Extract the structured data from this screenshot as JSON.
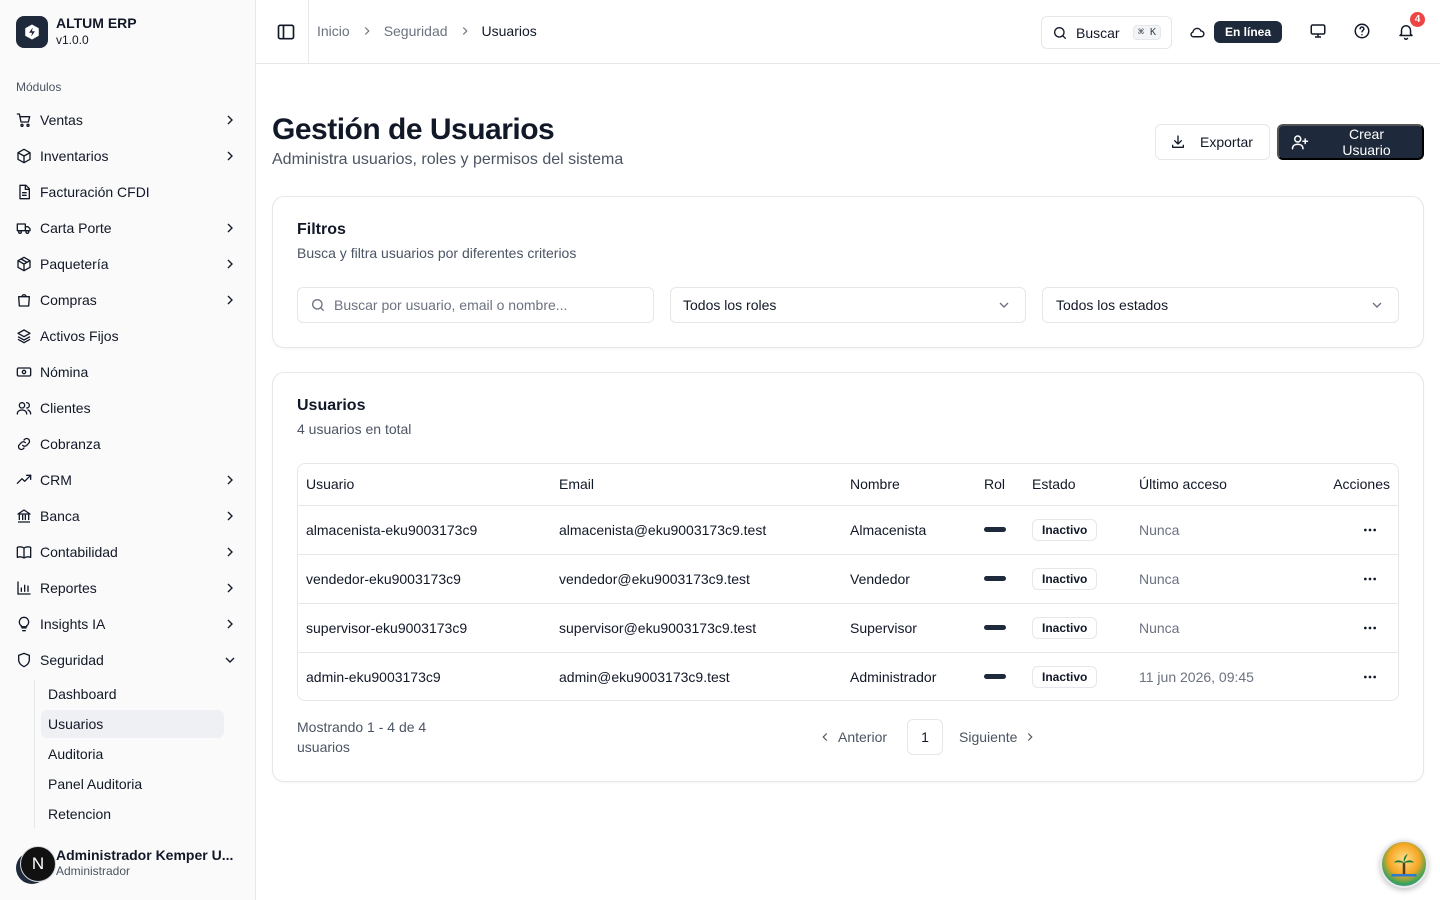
{
  "brand": {
    "name": "ALTUM ERP",
    "version": "v1.0.0"
  },
  "sidebar": {
    "section_label": "Módulos",
    "items": [
      {
        "label": "Ventas",
        "icon": "cart-icon",
        "expandable": true
      },
      {
        "label": "Inventarios",
        "icon": "box-icon",
        "expandable": true
      },
      {
        "label": "Facturación CFDI",
        "icon": "file-icon",
        "expandable": false
      },
      {
        "label": "Carta Porte",
        "icon": "truck-icon",
        "expandable": true
      },
      {
        "label": "Paquetería",
        "icon": "package-icon",
        "expandable": true
      },
      {
        "label": "Compras",
        "icon": "shopping-bag-icon",
        "expandable": true
      },
      {
        "label": "Activos Fijos",
        "icon": "layers-icon",
        "expandable": false
      },
      {
        "label": "Nómina",
        "icon": "banknote-icon",
        "expandable": false
      },
      {
        "label": "Clientes",
        "icon": "users-icon",
        "expandable": false
      },
      {
        "label": "Cobranza",
        "icon": "link-icon",
        "expandable": false
      },
      {
        "label": "CRM",
        "icon": "trending-up-icon",
        "expandable": true
      },
      {
        "label": "Banca",
        "icon": "bank-icon",
        "expandable": true
      },
      {
        "label": "Contabilidad",
        "icon": "book-icon",
        "expandable": true
      },
      {
        "label": "Reportes",
        "icon": "bar-chart-icon",
        "expandable": true
      },
      {
        "label": "Insights IA",
        "icon": "lightbulb-icon",
        "expandable": true
      }
    ],
    "security": {
      "label": "Seguridad",
      "icon": "shield-icon",
      "sub_items": [
        {
          "label": "Dashboard",
          "active": false
        },
        {
          "label": "Usuarios",
          "active": true
        },
        {
          "label": "Auditoria",
          "active": false
        },
        {
          "label": "Panel Auditoria",
          "active": false
        },
        {
          "label": "Retencion",
          "active": false
        }
      ]
    },
    "user": {
      "initial": "N",
      "name": "Administrador Kemper U...",
      "role": "Administrador"
    }
  },
  "header": {
    "breadcrumb": [
      "Inicio",
      "Seguridad",
      "Usuarios"
    ],
    "search_label": "Buscar",
    "search_shortcut": "⌘ K",
    "status": "En línea",
    "notifications_count": "4"
  },
  "page": {
    "title": "Gestión de Usuarios",
    "subtitle": "Administra usuarios, roles y permisos del sistema",
    "export_label": "Exportar",
    "create_label": "Crear Usuario"
  },
  "filters": {
    "title": "Filtros",
    "subtitle": "Busca y filtra usuarios por diferentes criterios",
    "search_placeholder": "Buscar por usuario, email o nombre...",
    "role_select": "Todos los roles",
    "status_select": "Todos los estados"
  },
  "users_table": {
    "title": "Usuarios",
    "subtitle": "4 usuarios en total",
    "columns": [
      "Usuario",
      "Email",
      "Nombre",
      "Rol",
      "Estado",
      "Último acceso",
      "Acciones"
    ],
    "rows": [
      {
        "user": "almacenista-eku9003173c9",
        "email": "almacenista@eku9003173c9.test",
        "name": "Almacenista",
        "status": "Inactivo",
        "last_access": "Nunca"
      },
      {
        "user": "vendedor-eku9003173c9",
        "email": "vendedor@eku9003173c9.test",
        "name": "Vendedor",
        "status": "Inactivo",
        "last_access": "Nunca"
      },
      {
        "user": "supervisor-eku9003173c9",
        "email": "supervisor@eku9003173c9.test",
        "name": "Supervisor",
        "status": "Inactivo",
        "last_access": "Nunca"
      },
      {
        "user": "admin-eku9003173c9",
        "email": "admin@eku9003173c9.test",
        "name": "Administrador",
        "status": "Inactivo",
        "last_access": "11 jun 2026, 09:45"
      }
    ],
    "pagination_info": "Mostrando 1 - 4 de 4 usuarios",
    "prev_label": "Anterior",
    "current_page": "1",
    "next_label": "Siguiente"
  },
  "colors": {
    "primary": "#1e2a3b",
    "border": "#e5e7eb",
    "muted_text": "#6b7280",
    "notification": "#ef4444"
  }
}
